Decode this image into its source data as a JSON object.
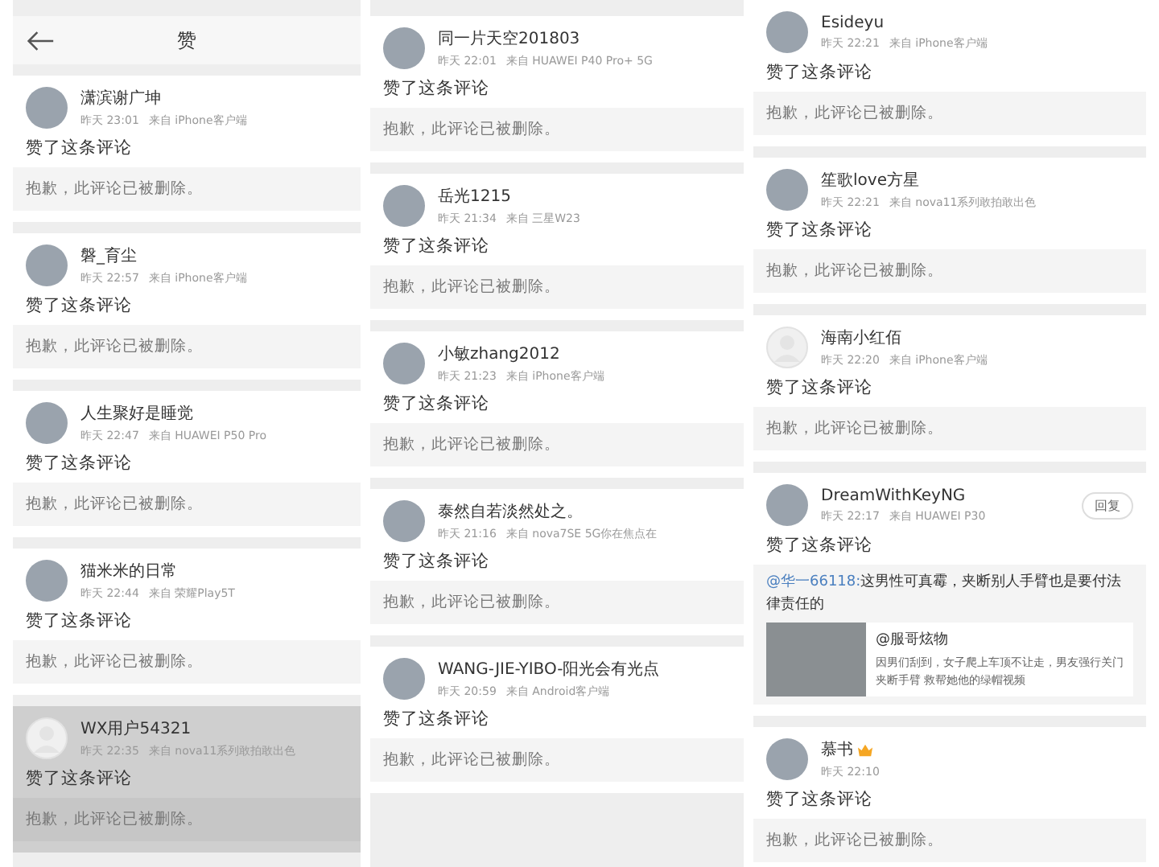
{
  "panels": [
    {
      "header": {
        "title": "赞"
      },
      "items": [
        {
          "name": "潇滨谢广坤",
          "time": "昨天 23:01",
          "source": "来自 iPhone客户端",
          "avatar": {
            "kind": "photo"
          },
          "action": "赞了这条评论",
          "deleted": "抱歉，此评论已被删除。",
          "pressed": false
        },
        {
          "name": "磐_育尘",
          "time": "昨天 22:57",
          "source": "来自 iPhone客户端",
          "avatar": {
            "kind": "photo"
          },
          "action": "赞了这条评论",
          "deleted": "抱歉，此评论已被删除。",
          "pressed": false
        },
        {
          "name": "人生聚好是睡觉",
          "time": "昨天 22:47",
          "source": "来自 HUAWEI P50 Pro",
          "avatar": {
            "kind": "photo"
          },
          "action": "赞了这条评论",
          "deleted": "抱歉，此评论已被删除。",
          "pressed": false
        },
        {
          "name": "猫米米的日常",
          "time": "昨天 22:44",
          "source": "来自 荣耀Play5T",
          "avatar": {
            "kind": "photo"
          },
          "action": "赞了这条评论",
          "deleted": "抱歉，此评论已被删除。",
          "pressed": false
        },
        {
          "name": "WX用户54321",
          "time": "昨天 22:35",
          "source": "来自 nova11系列敢拍敢出色",
          "avatar": {
            "kind": "default"
          },
          "action": "赞了这条评论",
          "deleted": "抱歉，此评论已被删除。",
          "pressed": true
        }
      ]
    },
    {
      "items": [
        {
          "name": "同一片天空201803",
          "time": "昨天 22:01",
          "source": "来自 HUAWEI P40 Pro+ 5G",
          "avatar": {
            "kind": "photo"
          },
          "action": "赞了这条评论",
          "deleted": "抱歉，此评论已被删除。",
          "pressed": false
        },
        {
          "name": "岳光1215",
          "time": "昨天 21:34",
          "source": "来自 三星W23",
          "avatar": {
            "kind": "photo"
          },
          "action": "赞了这条评论",
          "deleted": "抱歉，此评论已被删除。",
          "pressed": false
        },
        {
          "name": "小敏zhang2012",
          "time": "昨天 21:23",
          "source": "来自 iPhone客户端",
          "avatar": {
            "kind": "photo"
          },
          "action": "赞了这条评论",
          "deleted": "抱歉，此评论已被删除。",
          "pressed": false
        },
        {
          "name": "泰然自若淡然处之。",
          "time": "昨天 21:16",
          "source": "来自 nova7SE 5G你在焦点在",
          "avatar": {
            "kind": "photo"
          },
          "action": "赞了这条评论",
          "deleted": "抱歉，此评论已被删除。",
          "pressed": false
        },
        {
          "name": "WANG-JIE-YIBO-阳光会有光点",
          "time": "昨天 20:59",
          "source": "来自 Android客户端",
          "avatar": {
            "kind": "photo"
          },
          "action": "赞了这条评论",
          "deleted": "抱歉，此评论已被删除。",
          "pressed": false
        }
      ]
    },
    {
      "items": [
        {
          "name": "Esideyu",
          "time": "昨天 22:21",
          "source": "来自 iPhone客户端",
          "avatar": {
            "kind": "photo"
          },
          "action": "赞了这条评论",
          "deleted": "抱歉，此评论已被删除。",
          "pressed": false
        },
        {
          "name": "笙歌love方星",
          "time": "昨天 22:21",
          "source": "来自 nova11系列敢拍敢出色",
          "avatar": {
            "kind": "photo"
          },
          "action": "赞了这条评论",
          "deleted": "抱歉，此评论已被删除。",
          "pressed": false
        },
        {
          "name": "海南小红佰",
          "time": "昨天 22:20",
          "source": "来自 iPhone客户端",
          "avatar": {
            "kind": "default"
          },
          "action": "赞了这条评论",
          "deleted": "抱歉，此评论已被删除。",
          "pressed": false
        },
        {
          "name": "DreamWithKeyNG",
          "time": "昨天 22:17",
          "source": "来自 HUAWEI P30",
          "avatar": {
            "kind": "photo"
          },
          "action": "赞了这条评论",
          "reply": "回复",
          "pressed": false,
          "quote": {
            "mention": "@华一66118:",
            "text": "这男性可真霉，夹断别人手臂也是要付法律责任的",
            "card": {
              "title": "@服哥炫物",
              "text": "因男们刮到，女子爬上车顶不让走，男友强行关门夹断手臂 救帮她他的绿帽视频"
            }
          }
        },
        {
          "name": "慕书",
          "vip": true,
          "time": "昨天 22:10",
          "avatar": {
            "kind": "photo"
          },
          "action": "赞了这条评论",
          "deleted": "抱歉，此评论已被删除。",
          "pressed": false
        }
      ]
    }
  ]
}
